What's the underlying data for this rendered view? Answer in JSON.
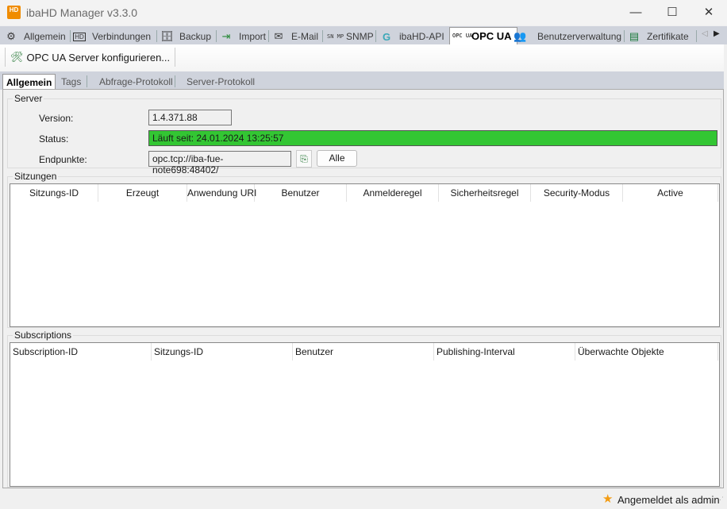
{
  "window": {
    "title": "ibaHD Manager v3.3.0",
    "icon_text": "HD"
  },
  "main_tabs": [
    {
      "label": "Allgemein",
      "icon": "gear-icon"
    },
    {
      "label": "Verbindungen",
      "icon": "monitor-hd-icon"
    },
    {
      "label": "Backup",
      "icon": "database-icon"
    },
    {
      "label": "Import",
      "icon": "import-icon"
    },
    {
      "label": "E-Mail",
      "icon": "mail-icon"
    },
    {
      "label": "SNMP",
      "icon": "snmp-icon"
    },
    {
      "label": "ibaHD-API",
      "icon": "api-icon"
    },
    {
      "label": "OPC UA",
      "icon": "opcua-icon",
      "active": true
    },
    {
      "label": "Benutzerverwaltung",
      "icon": "users-icon"
    },
    {
      "label": "Zertifikate",
      "icon": "certificate-icon"
    }
  ],
  "icon_text": {
    "snmp": "SN MP",
    "opcua": "OPC UA"
  },
  "toolbar": {
    "configure_label": "OPC UA Server konfigurieren..."
  },
  "sub_tabs": [
    "Allgemein",
    "Tags",
    "Abfrage-Protokoll",
    "Server-Protokoll"
  ],
  "server": {
    "group_label": "Server",
    "version_label": "Version:",
    "version": "1.4.371.88",
    "status_label": "Status:",
    "status": "Läuft seit: 24.01.2024 13:25:57",
    "status_color": "#33c633",
    "endpoints_label": "Endpunkte:",
    "endpoint": "opc.tcp://iba-fue-note698:48402/",
    "all_button": "Alle"
  },
  "sessions": {
    "group_label": "Sitzungen",
    "columns": [
      "Sitzungs-ID",
      "Erzeugt",
      "Anwendung URI",
      "Benutzer",
      "Anmelderegel",
      "Sicherheitsregel",
      "Security-Modus",
      "Active"
    ]
  },
  "subscriptions": {
    "group_label": "Subscriptions",
    "columns": [
      "Subscription-ID",
      "Sitzungs-ID",
      "Benutzer",
      "Publishing-Interval",
      "Überwachte Objekte"
    ]
  },
  "statusbar": {
    "login_text": "Angemeldet als admin"
  }
}
